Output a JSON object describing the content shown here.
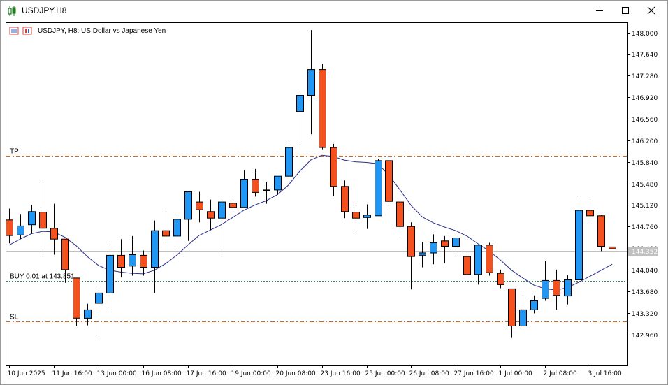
{
  "window": {
    "title": "USDJPY,H8",
    "icon": "candlestick-app-icon",
    "controls": {
      "minimize": "minimize-icon",
      "maximize": "maximize-icon",
      "close": "close-icon"
    }
  },
  "chart_header": {
    "text": "USDJPY, H8:  US Dollar vs Japanese Yen"
  },
  "colors": {
    "bull": "#2196F3",
    "bear": "#F4511E",
    "candle_border": "#000000",
    "ma_line": "#2B2E8C",
    "tp_sl_line": "#D2691E",
    "buy_line": "#2E8B57",
    "price_line": "#C0C0C0",
    "price_tag_bg": "#C0C0C0"
  },
  "chart_data": {
    "type": "candlestick",
    "symbol": "USDJPY",
    "timeframe": "H8",
    "ylim": [
      142.72,
      148.2
    ],
    "y_ticks": [
      "148.000",
      "147.640",
      "147.280",
      "146.920",
      "146.560",
      "146.200",
      "145.840",
      "145.480",
      "145.120",
      "144.760",
      "144.400",
      "144.040",
      "143.680",
      "143.320",
      "142.960"
    ],
    "x_labels": [
      "10 Jun 2025",
      "11 Jun 16:00",
      "13 Jun 00:00",
      "16 Jun 08:00",
      "17 Jun 16:00",
      "19 Jun 00:00",
      "20 Jun 08:00",
      "23 Jun 16:00",
      "25 Jun 00:00",
      "26 Jun 08:00",
      "27 Jun 16:00",
      "1 Jul 00:00",
      "2 Jul 08:00",
      "3 Jul 16:00"
    ],
    "x_label_bar_index": [
      0,
      4,
      8,
      12,
      16,
      20,
      24,
      28,
      32,
      36,
      40,
      44,
      48,
      52
    ],
    "candles": [
      {
        "o": 144.87,
        "h": 145.06,
        "l": 144.48,
        "c": 144.61
      },
      {
        "o": 144.62,
        "h": 144.97,
        "l": 144.55,
        "c": 144.77
      },
      {
        "o": 144.79,
        "h": 145.12,
        "l": 144.64,
        "c": 145.01
      },
      {
        "o": 145.0,
        "h": 145.5,
        "l": 144.31,
        "c": 144.73
      },
      {
        "o": 144.73,
        "h": 145.14,
        "l": 144.29,
        "c": 144.55
      },
      {
        "o": 144.55,
        "h": 144.55,
        "l": 143.82,
        "c": 144.04
      },
      {
        "o": 143.9,
        "h": 143.9,
        "l": 143.1,
        "c": 143.23
      },
      {
        "o": 143.23,
        "h": 143.47,
        "l": 143.11,
        "c": 143.37
      },
      {
        "o": 143.48,
        "h": 143.74,
        "l": 142.88,
        "c": 143.65
      },
      {
        "o": 143.65,
        "h": 144.46,
        "l": 143.34,
        "c": 144.28
      },
      {
        "o": 144.28,
        "h": 144.55,
        "l": 143.91,
        "c": 144.08
      },
      {
        "o": 144.1,
        "h": 144.6,
        "l": 143.94,
        "c": 144.29
      },
      {
        "o": 144.28,
        "h": 144.36,
        "l": 143.94,
        "c": 144.08
      },
      {
        "o": 144.08,
        "h": 144.86,
        "l": 143.65,
        "c": 144.69
      },
      {
        "o": 144.69,
        "h": 145.06,
        "l": 144.45,
        "c": 144.6
      },
      {
        "o": 144.6,
        "h": 144.98,
        "l": 144.36,
        "c": 144.88
      },
      {
        "o": 144.88,
        "h": 145.35,
        "l": 144.52,
        "c": 145.34
      },
      {
        "o": 145.17,
        "h": 145.34,
        "l": 144.83,
        "c": 145.04
      },
      {
        "o": 145.01,
        "h": 145.21,
        "l": 144.7,
        "c": 144.9
      },
      {
        "o": 144.9,
        "h": 145.21,
        "l": 144.31,
        "c": 145.17
      },
      {
        "o": 145.15,
        "h": 145.21,
        "l": 145.01,
        "c": 145.08
      },
      {
        "o": 145.08,
        "h": 145.7,
        "l": 145.07,
        "c": 145.55
      },
      {
        "o": 145.55,
        "h": 145.72,
        "l": 145.26,
        "c": 145.33
      },
      {
        "o": 145.37,
        "h": 145.51,
        "l": 145.14,
        "c": 145.37
      },
      {
        "o": 145.37,
        "h": 145.58,
        "l": 145.29,
        "c": 145.6
      },
      {
        "o": 145.6,
        "h": 146.14,
        "l": 145.55,
        "c": 146.08
      },
      {
        "o": 146.68,
        "h": 147.0,
        "l": 146.14,
        "c": 146.95
      },
      {
        "o": 146.95,
        "h": 148.04,
        "l": 146.3,
        "c": 147.38
      },
      {
        "o": 147.38,
        "h": 147.48,
        "l": 146.05,
        "c": 146.08
      },
      {
        "o": 146.08,
        "h": 146.14,
        "l": 145.27,
        "c": 145.43
      },
      {
        "o": 145.43,
        "h": 145.53,
        "l": 144.9,
        "c": 145.01
      },
      {
        "o": 145.0,
        "h": 145.16,
        "l": 144.63,
        "c": 144.9
      },
      {
        "o": 144.91,
        "h": 145.13,
        "l": 144.72,
        "c": 144.95
      },
      {
        "o": 144.94,
        "h": 145.89,
        "l": 144.94,
        "c": 145.86
      },
      {
        "o": 145.86,
        "h": 145.93,
        "l": 145.07,
        "c": 145.18
      },
      {
        "o": 145.17,
        "h": 145.2,
        "l": 144.62,
        "c": 144.76
      },
      {
        "o": 144.76,
        "h": 144.83,
        "l": 143.71,
        "c": 144.26
      },
      {
        "o": 144.28,
        "h": 144.5,
        "l": 144.08,
        "c": 144.32
      },
      {
        "o": 144.32,
        "h": 144.63,
        "l": 144.13,
        "c": 144.49
      },
      {
        "o": 144.52,
        "h": 144.6,
        "l": 144.15,
        "c": 144.43
      },
      {
        "o": 144.43,
        "h": 144.72,
        "l": 144.33,
        "c": 144.57
      },
      {
        "o": 144.26,
        "h": 144.31,
        "l": 143.93,
        "c": 143.96
      },
      {
        "o": 143.96,
        "h": 144.45,
        "l": 143.79,
        "c": 144.45
      },
      {
        "o": 144.45,
        "h": 144.49,
        "l": 143.94,
        "c": 143.99
      },
      {
        "o": 143.98,
        "h": 144.04,
        "l": 143.73,
        "c": 143.79
      },
      {
        "o": 143.72,
        "h": 143.72,
        "l": 142.9,
        "c": 143.1
      },
      {
        "o": 143.1,
        "h": 143.68,
        "l": 143.04,
        "c": 143.37
      },
      {
        "o": 143.37,
        "h": 143.61,
        "l": 143.31,
        "c": 143.52
      },
      {
        "o": 143.56,
        "h": 144.18,
        "l": 143.52,
        "c": 143.86
      },
      {
        "o": 143.86,
        "h": 144.04,
        "l": 143.37,
        "c": 143.61
      },
      {
        "o": 143.6,
        "h": 143.95,
        "l": 143.46,
        "c": 143.87
      },
      {
        "o": 143.87,
        "h": 145.24,
        "l": 143.85,
        "c": 145.03
      },
      {
        "o": 145.03,
        "h": 145.22,
        "l": 144.85,
        "c": 144.94
      },
      {
        "o": 144.94,
        "h": 144.96,
        "l": 144.35,
        "c": 144.43
      },
      {
        "o": 144.42,
        "h": 144.42,
        "l": 144.39,
        "c": 144.39
      }
    ],
    "moving_average": [
      144.45,
      144.55,
      144.64,
      144.68,
      144.67,
      144.58,
      144.44,
      144.26,
      144.11,
      144.03,
      144.0,
      143.98,
      143.97,
      144.03,
      144.14,
      144.28,
      144.45,
      144.61,
      144.7,
      144.79,
      144.91,
      145.03,
      145.12,
      145.19,
      145.29,
      145.45,
      145.68,
      145.87,
      145.95,
      145.93,
      145.87,
      145.84,
      145.83,
      145.81,
      145.62,
      145.37,
      145.11,
      144.92,
      144.82,
      144.75,
      144.69,
      144.6,
      144.47,
      144.35,
      144.2,
      144.03,
      143.9,
      143.78,
      143.72,
      143.7,
      143.74,
      143.83,
      143.93,
      144.03,
      144.13
    ],
    "levels": {
      "tp": {
        "label": "TP",
        "price": 145.94
      },
      "buy": {
        "label": "BUY 0.01 at 143.851",
        "price": 143.851
      },
      "sl": {
        "label": "SL",
        "price": 143.18
      }
    },
    "current_price": "144.352"
  }
}
